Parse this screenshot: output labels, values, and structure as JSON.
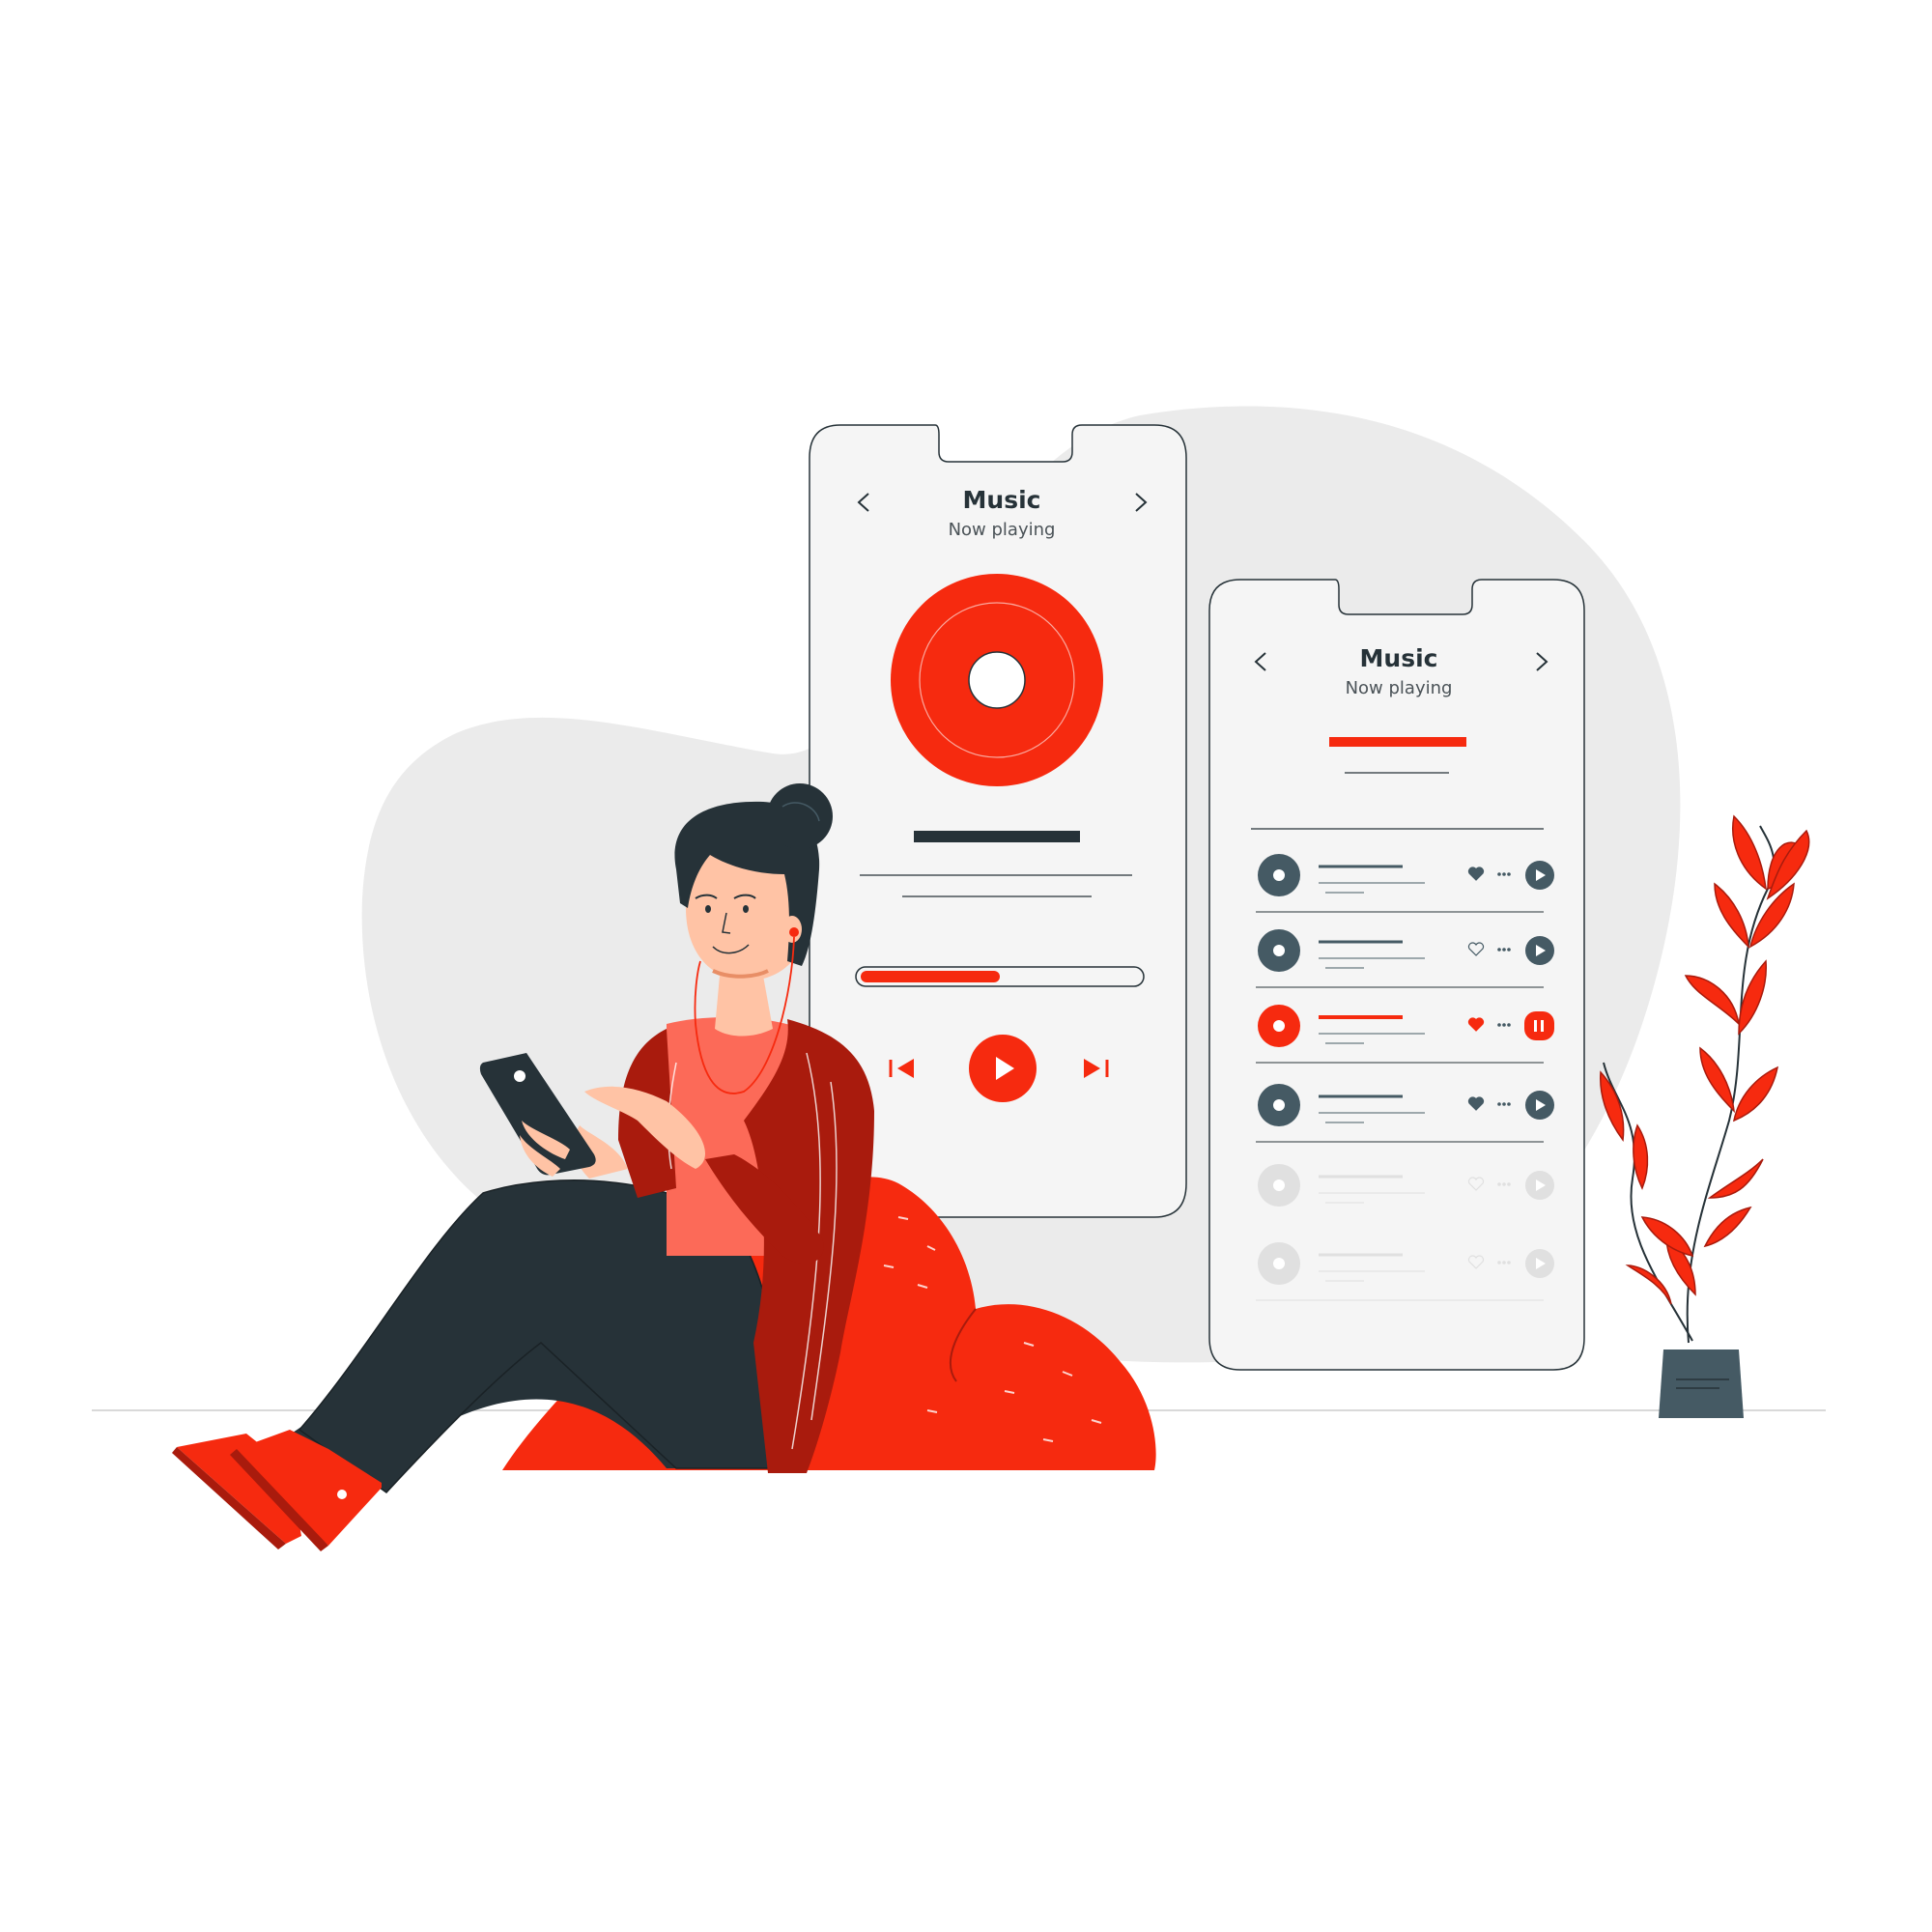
{
  "player_screen": {
    "title": "Music",
    "subtitle": "Now playing",
    "progress": 0.5
  },
  "playlist_screen": {
    "title": "Music",
    "subtitle": "Now playing",
    "tracks": [
      {
        "state": "idle",
        "liked": true
      },
      {
        "state": "idle",
        "liked": false
      },
      {
        "state": "playing",
        "liked": true
      },
      {
        "state": "idle",
        "liked": true
      },
      {
        "state": "disabled",
        "liked": false
      },
      {
        "state": "disabled",
        "liked": false
      }
    ]
  },
  "colors": {
    "accent": "#f62a0f",
    "dark_red": "#a91b0d",
    "dark": "#263238",
    "track_dark": "#455a64",
    "phone_bg": "#f5f5f5",
    "blob": "#ebebeb",
    "skin": "#ffc3a5",
    "shirt": "#fc6a58"
  }
}
